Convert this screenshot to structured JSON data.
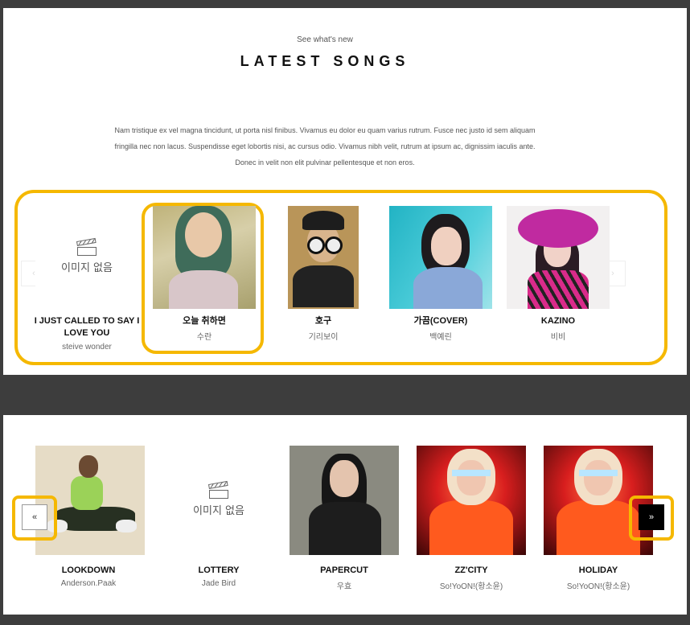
{
  "header": {
    "eyebrow": "See what's new",
    "title": "LATEST SONGS",
    "description": "Nam tristique ex vel magna tincidunt, ut porta nisl finibus. Vivamus eu dolor eu quam varius rutrum. Fusce nec justo id sem aliquam fringilla nec non lacus. Suspendisse eget lobortis nisi, ac cursus odio. Vivamus nibh velit, rutrum at ipsum ac, dignissim iaculis ante. Donec in velit non elit pulvinar pellentesque et non eros."
  },
  "no_image_label": "이미지 없음",
  "slider_top": {
    "items": [
      {
        "title": "I JUST CALLED TO SAY I LOVE YOU",
        "artist": "steive wonder",
        "image": "none"
      },
      {
        "title": "오늘 취하면",
        "artist": "수란",
        "image": "photo"
      },
      {
        "title": "호구",
        "artist": "기리보이",
        "image": "photo"
      },
      {
        "title": "가끔(COVER)",
        "artist": "백예린",
        "image": "photo"
      },
      {
        "title": "KAZINO",
        "artist": "비비",
        "image": "photo"
      }
    ]
  },
  "slider_bottom": {
    "prev_label": "«",
    "next_label": "»",
    "items": [
      {
        "title": "LOOKDOWN",
        "artist": "Anderson.Paak",
        "image": "photo"
      },
      {
        "title": "LOTTERY",
        "artist": "Jade Bird",
        "image": "none"
      },
      {
        "title": "PAPERCUT",
        "artist": "우효",
        "image": "photo"
      },
      {
        "title": "ZZ'CITY",
        "artist": "So!YoON!(황소윤)",
        "image": "photo"
      },
      {
        "title": "HOLIDAY",
        "artist": "So!YoON!(황소윤)",
        "image": "photo"
      }
    ]
  },
  "colors": {
    "highlight": "#f5b800",
    "background": "#3d3d3d"
  }
}
